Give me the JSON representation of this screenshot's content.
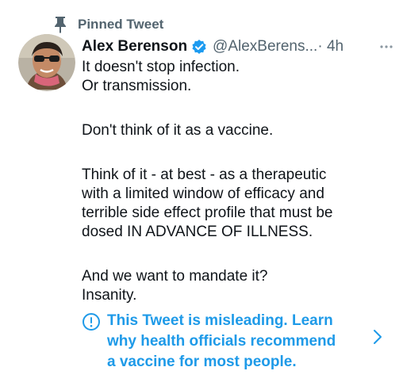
{
  "pinned": {
    "label": "Pinned Tweet",
    "icon": "pin-icon"
  },
  "tweet": {
    "display_name": "Alex Berenson",
    "verified": true,
    "verified_icon": "verified-badge-icon",
    "handle": "@AlexBerens...",
    "time": "· 4h",
    "more_icon": "more-dots-icon",
    "body_lines": [
      "It doesn't stop infection.",
      "Or transmission.",
      "",
      "Don't think of it as a vaccine.",
      "",
      "Think of it - at best - as a therapeutic",
      "with a limited window of efficacy and",
      "terrible side effect profile that must be",
      "dosed IN ADVANCE OF ILLNESS.",
      "",
      "And we want to mandate it?",
      "Insanity."
    ]
  },
  "notice": {
    "icon": "exclamation-circle-icon",
    "lines": [
      "This Tweet is misleading. Learn",
      "why health officials recommend",
      "a vaccine for most people."
    ],
    "chevron_icon": "chevron-right-icon"
  },
  "colors": {
    "text": "#0f1419",
    "secondary": "#53646f",
    "accent": "#1e9ae8",
    "verified": "#1d9bf0"
  }
}
